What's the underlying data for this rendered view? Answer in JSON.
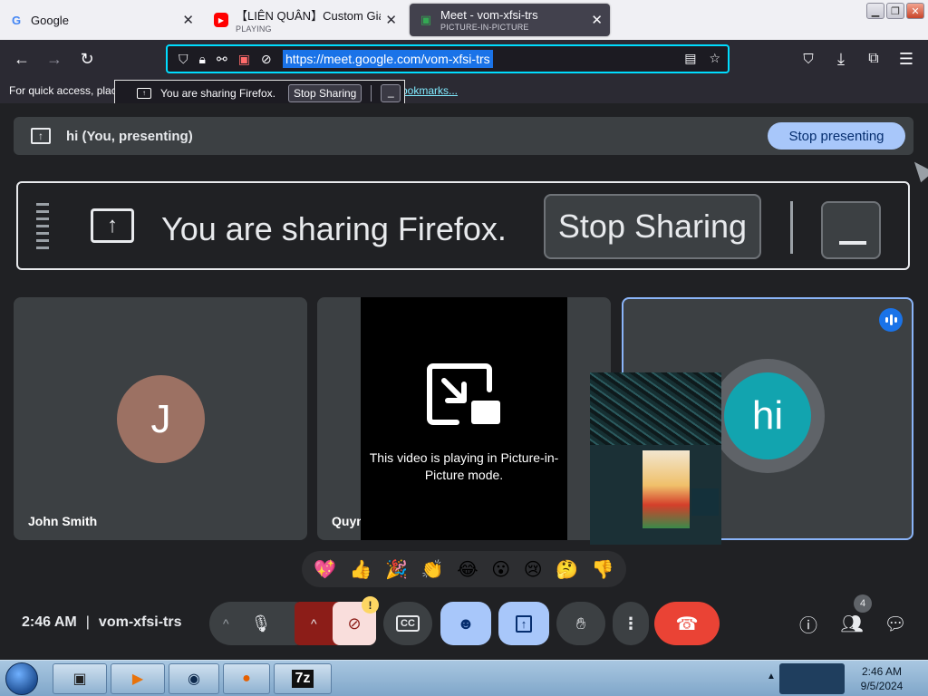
{
  "browser": {
    "tabs": [
      {
        "title": "Google",
        "subtitle": "",
        "favicon": "google-favicon"
      },
      {
        "title": "【LIÊN QUÂN】Custom Giao H",
        "subtitle": "PLAYING",
        "favicon": "youtube-favicon"
      },
      {
        "title": "Meet - vom-xfsi-trs",
        "subtitle": "PICTURE-IN-PICTURE",
        "favicon": "meet-favicon"
      }
    ],
    "url": "https://meet.google.com/vom-xfsi-trs",
    "bookmarks_hint_left": "For quick access, plac",
    "bookmarks_hint_right": "ookmarks...",
    "sharing_popup": {
      "text": "You are sharing Firefox.",
      "button": "Stop Sharing"
    }
  },
  "meet": {
    "presenting_label": "hi (You, presenting)",
    "stop_presenting": "Stop presenting",
    "share_banner": {
      "text": "You are sharing Firefox.",
      "button": "Stop Sharing"
    },
    "participants": [
      {
        "name": "John Smith",
        "initial": "J",
        "avatar_color": "#9c7163"
      },
      {
        "name": "Quynh Anh Vu",
        "pip_message": "This video is playing in Picture-in-Picture mode."
      },
      {
        "name": "",
        "initial": "hi",
        "avatar_color": "#12a4af",
        "speaking": true
      }
    ],
    "reactions": [
      "💖",
      "👍",
      "🎉",
      "👏",
      "😂",
      "😮",
      "😢",
      "🤔",
      "👎"
    ],
    "time": "2:46 AM",
    "meeting_code": "vom-xfsi-trs",
    "warning_badge": "!",
    "people_count": "4",
    "accent": "#a8c7fa",
    "end_call_color": "#ea4335"
  },
  "taskbar": {
    "apps": [
      "explorer",
      "media-player",
      "network",
      "firefox",
      "7zip"
    ],
    "app_7zip_label": "7z",
    "clock_time": "2:46 AM",
    "clock_date": "9/5/2024"
  }
}
